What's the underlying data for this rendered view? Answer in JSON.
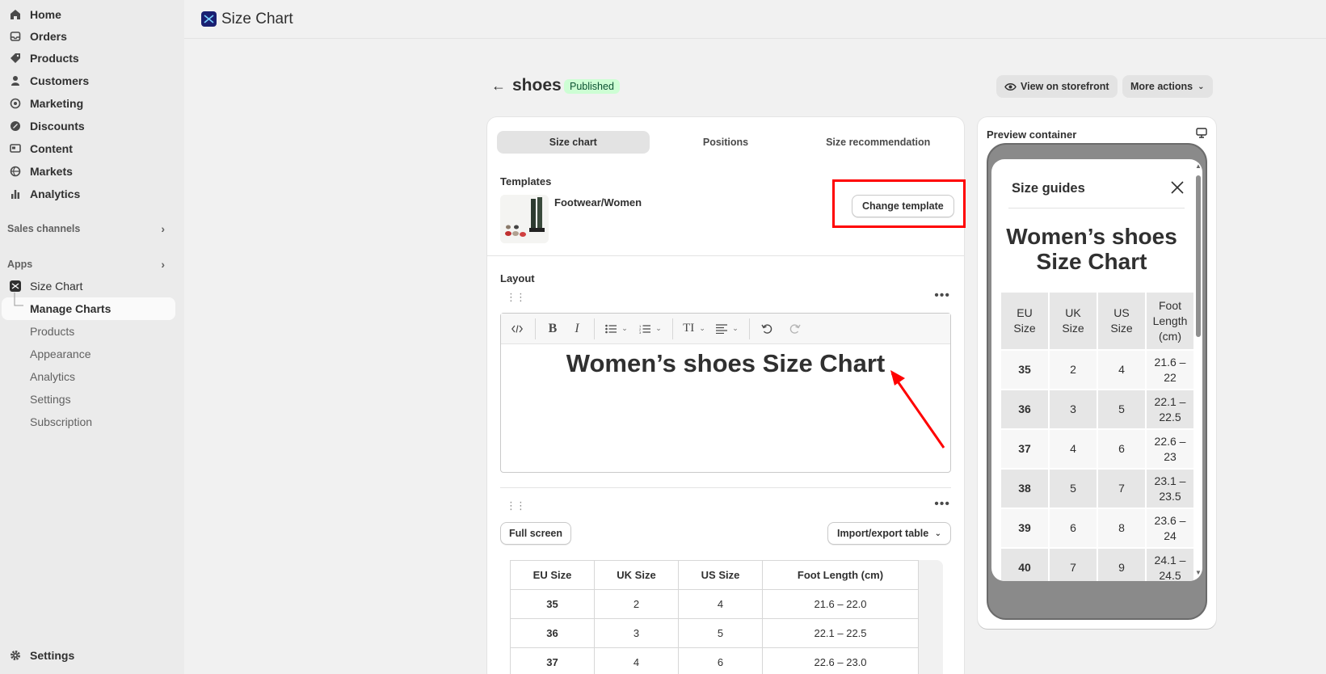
{
  "sidebar": {
    "items": [
      {
        "label": "Home",
        "icon": "home-icon"
      },
      {
        "label": "Orders",
        "icon": "inbox-icon"
      },
      {
        "label": "Products",
        "icon": "tag-icon"
      },
      {
        "label": "Customers",
        "icon": "person-icon"
      },
      {
        "label": "Marketing",
        "icon": "target-icon"
      },
      {
        "label": "Discounts",
        "icon": "discount-icon"
      },
      {
        "label": "Content",
        "icon": "content-icon"
      },
      {
        "label": "Markets",
        "icon": "globe-icon"
      },
      {
        "label": "Analytics",
        "icon": "bar-chart-icon"
      }
    ],
    "sales_channels": "Sales channels",
    "apps": "Apps",
    "app_name": "Size Chart",
    "app_sub": [
      "Manage Charts",
      "Products",
      "Appearance",
      "Analytics",
      "Settings",
      "Subscription"
    ],
    "settings": "Settings"
  },
  "topbar": {
    "title": "Size Chart"
  },
  "page": {
    "title": "shoes",
    "status": "Published",
    "view_storefront": "View on storefront",
    "more_actions": "More actions"
  },
  "tabs": [
    "Size chart",
    "Positions",
    "Size recommendation"
  ],
  "templates": {
    "label": "Templates",
    "name": "Footwear/Women",
    "change": "Change template"
  },
  "layout": {
    "label": "Layout",
    "heading": "Women’s shoes Size Chart",
    "full_screen": "Full screen",
    "import_export": "Import/export table"
  },
  "size_table": {
    "headers": [
      "EU Size",
      "UK Size",
      "US Size",
      "Foot Length (cm)"
    ],
    "rows": [
      [
        "35",
        "2",
        "4",
        "21.6 – 22.0"
      ],
      [
        "36",
        "3",
        "5",
        "22.1 – 22.5"
      ],
      [
        "37",
        "4",
        "6",
        "22.6 – 23.0"
      ]
    ]
  },
  "preview": {
    "title": "Preview container",
    "guide_title": "Size guides",
    "heading_line1": "Women’s shoes",
    "heading_line2": "Size Chart",
    "headers": [
      [
        "EU",
        "Size"
      ],
      [
        "UK",
        "Size"
      ],
      [
        "US",
        "Size"
      ],
      [
        "Foot",
        "Length",
        "(cm)"
      ]
    ],
    "rows": [
      [
        "35",
        "2",
        "4",
        "21.6 –",
        "22"
      ],
      [
        "36",
        "3",
        "5",
        "22.1 –",
        "22.5"
      ],
      [
        "37",
        "4",
        "6",
        "22.6 –",
        "23"
      ],
      [
        "38",
        "5",
        "7",
        "23.1 –",
        "23.5"
      ],
      [
        "39",
        "6",
        "8",
        "23.6 –",
        "24"
      ],
      [
        "40",
        "7",
        "9",
        "24.1 –",
        "24.5"
      ]
    ]
  },
  "colors": {
    "accent_red": "#ff0000",
    "badge_bg": "#cdfed4",
    "app_logo": "#1a1f71"
  }
}
